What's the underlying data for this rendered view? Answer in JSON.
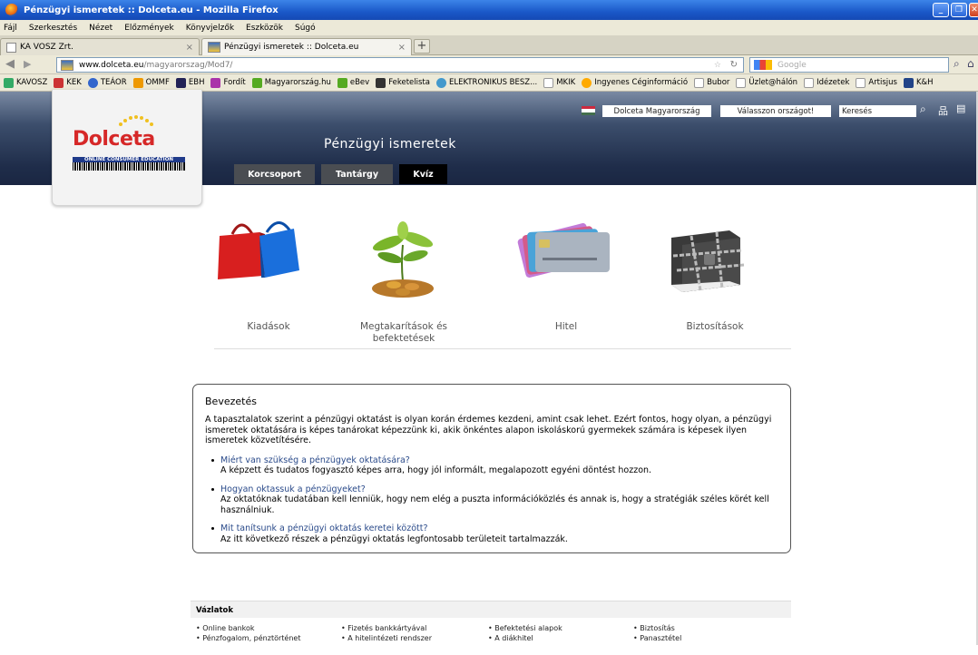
{
  "window": {
    "title": "Pénzügyi ismeretek :: Dolceta.eu - Mozilla Firefox"
  },
  "menu": [
    "Fájl",
    "Szerkesztés",
    "Nézet",
    "Előzmények",
    "Könyvjelzők",
    "Eszközök",
    "Súgó"
  ],
  "tabs": [
    {
      "label": "KA VOSZ Zrt.",
      "close": "×"
    },
    {
      "label": "Pénzügyi ismeretek :: Dolceta.eu",
      "close": "×"
    }
  ],
  "newtab": "+",
  "address": {
    "host": "www.dolceta.eu",
    "path": "/magyarorszag/Mod7/"
  },
  "websearch": {
    "placeholder": "Google"
  },
  "bookmarks": [
    "KAVOSZ",
    "KEK",
    "TEÁOR",
    "OMMF",
    "EBH",
    "Fordít",
    "Magyarország.hu",
    "eBev",
    "Feketelista",
    "ELEKTRONIKUS BESZ...",
    "MKIK",
    "Ingyenes Céginformáció",
    "Bubor",
    "Üzlet@hálón",
    "Idézetek",
    "Artisjus",
    "K&H"
  ],
  "colors": {
    "header_dark": "#1f2d4a",
    "tab_gray": "#4a4d52",
    "tab_active": "#000000",
    "link": "#2a4a8a"
  },
  "logo": {
    "brand": "Dolceta",
    "tagline": "ONLINE CONSUMER EDUCATION"
  },
  "site": {
    "title": "Pénzügyi ismeretek",
    "country_link": "Dolceta Magyarország",
    "choose_country": "Válasszon országot!",
    "search_value": "Keresés",
    "nav": [
      "Korcsoport",
      "Tantárgy",
      "Kvíz"
    ]
  },
  "categories": [
    {
      "label": "Kiadások",
      "icon": "shopping-bags-icon"
    },
    {
      "label": "Megtakarítások és befektetések",
      "icon": "plant-coins-icon"
    },
    {
      "label": "Hitel",
      "icon": "credit-cards-icon"
    },
    {
      "label": "Biztosítások",
      "icon": "chained-book-icon"
    }
  ],
  "intro": {
    "heading": "Bevezetés",
    "text": "A tapasztalatok szerint a pénzügyi oktatást is olyan korán érdemes kezdeni, amint csak lehet. Ezért fontos, hogy olyan, a pénzügyi ismeretek oktatására is képes tanárokat képezzünk ki, akik önkéntes alapon iskoláskorú gyermekek számára is képesek ilyen ismeretek közvetítésére.",
    "items": [
      {
        "link": "Miért van szükség a pénzügyek oktatására?",
        "desc": "A képzett és tudatos fogyasztó képes arra, hogy jól informált, megalapozott egyéni döntést hozzon."
      },
      {
        "link": "Hogyan oktassuk a pénzügyeket?",
        "desc": "Az oktatóknak tudatában kell lenniük, hogy nem elég a puszta információközlés és annak is, hogy a stratégiák széles körét kell használniuk."
      },
      {
        "link": "Mit tanítsunk a pénzügyi oktatás keretei között?",
        "desc": "Az itt következő részek a pénzügyi oktatás legfontosabb területeit tartalmazzák."
      }
    ]
  },
  "outline": {
    "title": "Vázlatok",
    "columns": [
      [
        "Online bankok",
        "Pénzfogalom, pénztörténet"
      ],
      [
        "Fizetés bankkártyával",
        "A hitelintézeti rendszer"
      ],
      [
        "Befektetési alapok",
        "A diákhitel"
      ],
      [
        "Biztosítás",
        "Panasztétel"
      ]
    ]
  }
}
